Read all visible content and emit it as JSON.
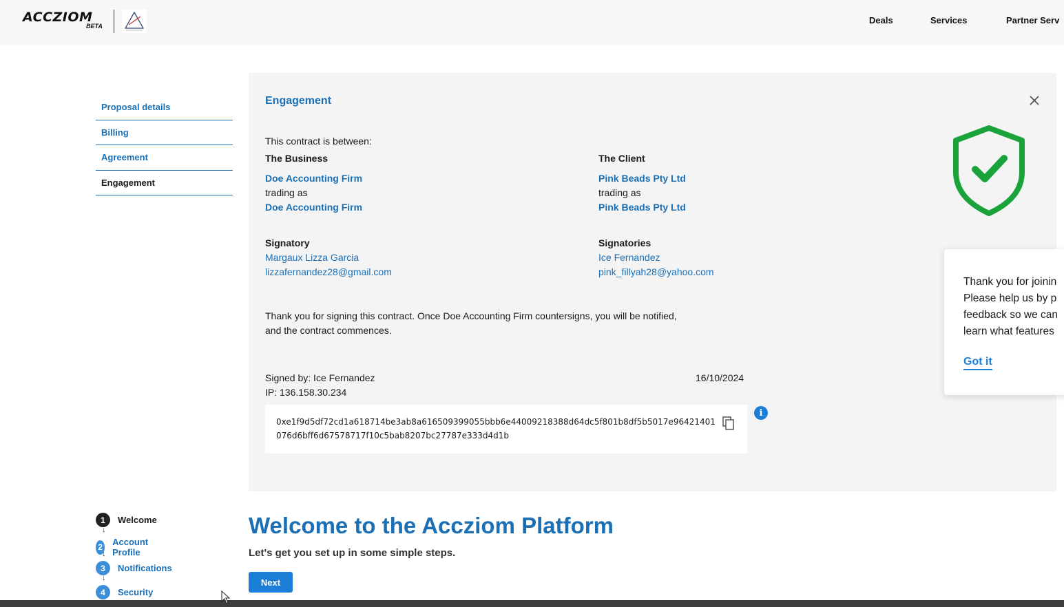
{
  "header": {
    "logo_text": "ACCZIOM",
    "logo_badge": "BETA",
    "nav": [
      "Deals",
      "Services",
      "Partner Serv"
    ]
  },
  "sidebar": {
    "items": [
      {
        "label": "Proposal details"
      },
      {
        "label": "Billing"
      },
      {
        "label": "Agreement"
      },
      {
        "label": "Engagement"
      }
    ]
  },
  "panel": {
    "title": "Engagement",
    "intro": "This contract is between:",
    "business": {
      "heading": "The Business",
      "name": "Doe Accounting Firm",
      "trading_as": "trading as",
      "trading_name": "Doe Accounting Firm",
      "signatory_heading": "Signatory",
      "signatory_name": "Margaux Lizza Garcia",
      "signatory_email": "lizzafernandez28@gmail.com"
    },
    "client": {
      "heading": "The Client",
      "name": "Pink Beads Pty Ltd",
      "trading_as": "trading as",
      "trading_name": "Pink Beads Pty Ltd",
      "signatory_heading": "Signatories",
      "signatory_name": "Ice Fernandez",
      "signatory_email": "pink_fillyah28@yahoo.com"
    },
    "message_line1": "Thank you for signing this contract. Once Doe Accounting Firm countersigns, you will be notified,",
    "message_line2": "and the contract commences.",
    "signed_by": "Signed by: Ice Fernandez",
    "ip": "IP: 136.158.30.234",
    "date": "16/10/2024",
    "hash": "0xe1f9d5df72cd1a618714be3ab8a616509399055bbb6e44009218388d64dc5f801b8df5b5017e96421401076d6bff6d67578717f10c5bab8207bc27787e333d4d1b"
  },
  "toast": {
    "lines": [
      "Thank you for joinin",
      "Please help us by p",
      "feedback so we can",
      "learn what features"
    ],
    "button": "Got it"
  },
  "onboarding": {
    "steps": [
      {
        "num": "1",
        "label": "Welcome"
      },
      {
        "num": "2",
        "label": "Account Profile"
      },
      {
        "num": "3",
        "label": "Notifications"
      },
      {
        "num": "4",
        "label": "Security"
      }
    ],
    "title": "Welcome to the Accziom Platform",
    "subtitle": "Let's get you set up in some simple steps.",
    "next_label": "Next"
  },
  "colors": {
    "accent": "#1b6fb5",
    "button": "#1b7fd8",
    "shield_green": "#1aa33a",
    "panel_bg": "#f4f4f4"
  }
}
